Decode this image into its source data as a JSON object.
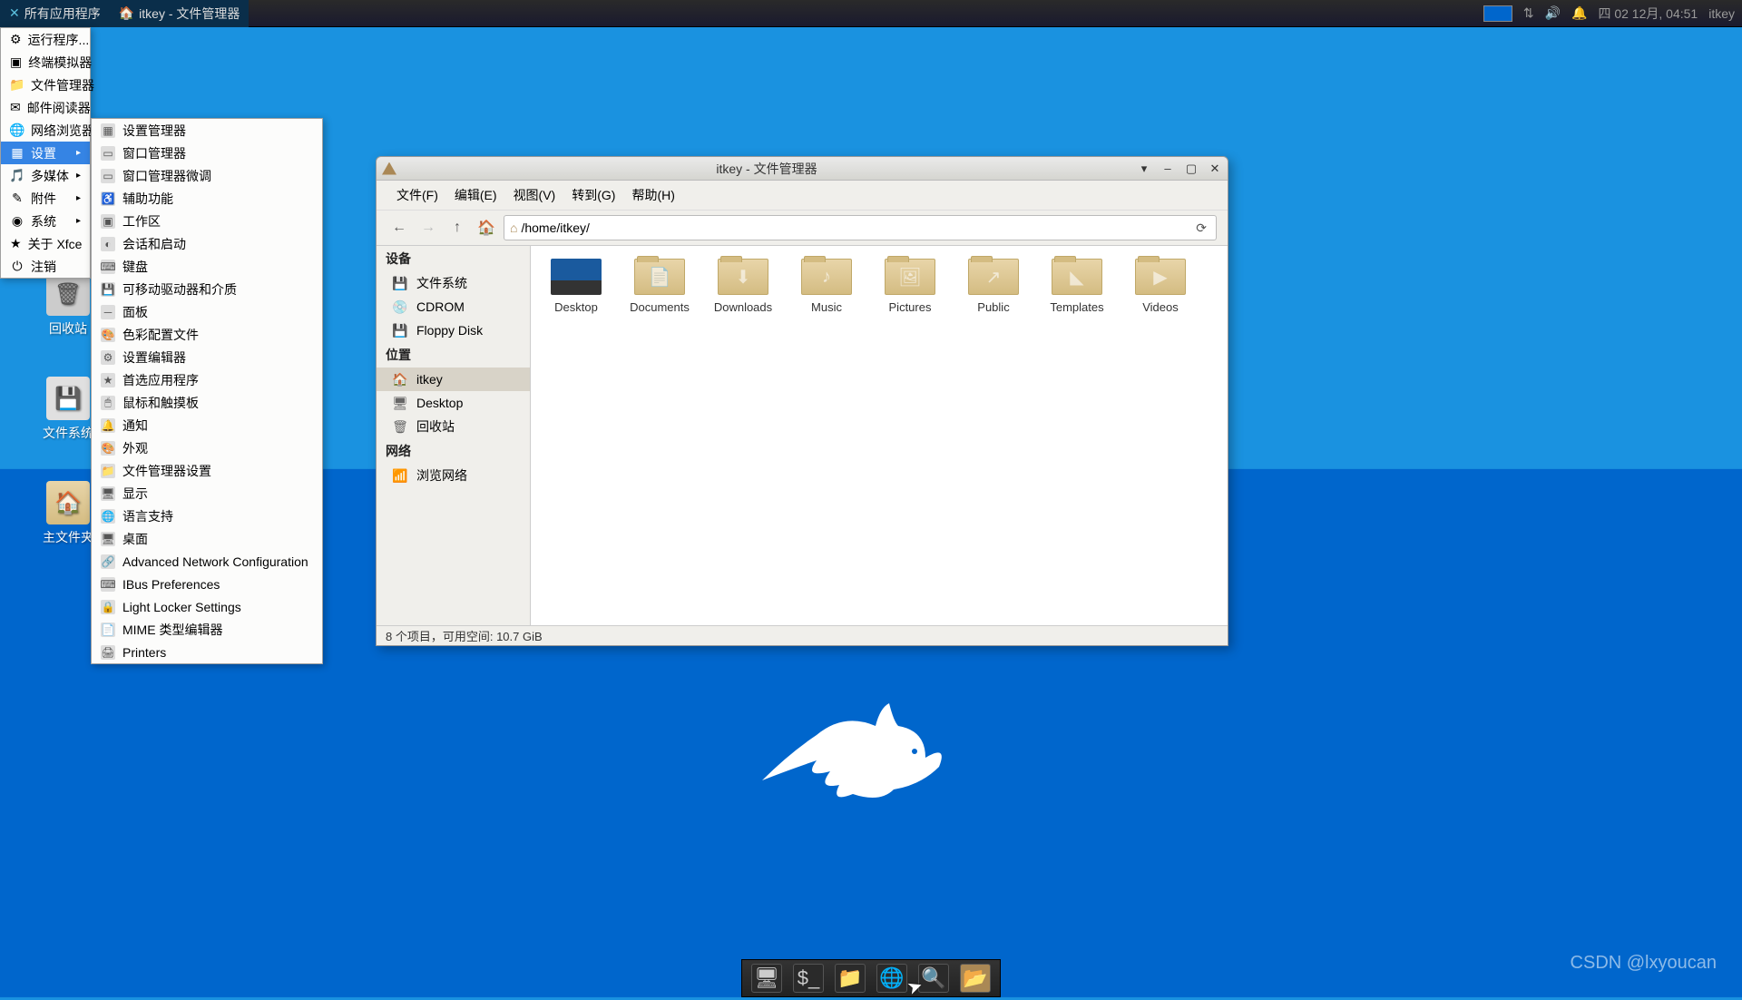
{
  "panel": {
    "apps_menu": "所有应用程序",
    "window_task": "itkey - 文件管理器",
    "clock": "四 02 12月, 04:51",
    "user": "itkey"
  },
  "desktop": {
    "trash": "回收站",
    "filesystem": "文件系统",
    "home": "主文件夹"
  },
  "start_menu": {
    "items": [
      {
        "label": "运行程序...",
        "icon": "⚙"
      },
      {
        "label": "终端模拟器",
        "icon": "▣"
      },
      {
        "label": "文件管理器",
        "icon": "📁"
      },
      {
        "label": "邮件阅读器",
        "icon": "✉"
      },
      {
        "label": "网络浏览器",
        "icon": "🌐"
      },
      {
        "label": "设置",
        "icon": "▦",
        "arrow": true,
        "active": true
      },
      {
        "label": "多媒体",
        "icon": "🎵",
        "arrow": true
      },
      {
        "label": "附件",
        "icon": "✎",
        "arrow": true
      },
      {
        "label": "系统",
        "icon": "◉",
        "arrow": true
      },
      {
        "label": "关于 Xfce",
        "icon": "★"
      },
      {
        "label": "注销",
        "icon": "⏻"
      }
    ]
  },
  "settings_submenu": {
    "items": [
      {
        "label": "设置管理器",
        "icon": "▦"
      },
      {
        "label": "窗口管理器",
        "icon": "▭"
      },
      {
        "label": "窗口管理器微调",
        "icon": "▭"
      },
      {
        "label": "辅助功能",
        "icon": "♿"
      },
      {
        "label": "工作区",
        "icon": "▣"
      },
      {
        "label": "会话和启动",
        "icon": "◐"
      },
      {
        "label": "键盘",
        "icon": "⌨"
      },
      {
        "label": "可移动驱动器和介质",
        "icon": "💾"
      },
      {
        "label": "面板",
        "icon": "─"
      },
      {
        "label": "色彩配置文件",
        "icon": "🎨"
      },
      {
        "label": "设置编辑器",
        "icon": "⚙"
      },
      {
        "label": "首选应用程序",
        "icon": "★"
      },
      {
        "label": "鼠标和触摸板",
        "icon": "🖱"
      },
      {
        "label": "通知",
        "icon": "🔔"
      },
      {
        "label": "外观",
        "icon": "🎨"
      },
      {
        "label": "文件管理器设置",
        "icon": "📁"
      },
      {
        "label": "显示",
        "icon": "🖥"
      },
      {
        "label": "语言支持",
        "icon": "🌐"
      },
      {
        "label": "桌面",
        "icon": "🖥"
      },
      {
        "label": "Advanced Network Configuration",
        "icon": "🔗"
      },
      {
        "label": "IBus Preferences",
        "icon": "⌨"
      },
      {
        "label": "Light Locker Settings",
        "icon": "🔒"
      },
      {
        "label": "MIME 类型编辑器",
        "icon": "📄"
      },
      {
        "label": "Printers",
        "icon": "🖨"
      }
    ]
  },
  "fm": {
    "title": "itkey - 文件管理器",
    "menus": [
      "文件(F)",
      "编辑(E)",
      "视图(V)",
      "转到(G)",
      "帮助(H)"
    ],
    "path": "/home/itkey/",
    "sidebar": {
      "devices_hdr": "设备",
      "devices": [
        {
          "label": "文件系统",
          "icon": "💾"
        },
        {
          "label": "CDROM",
          "icon": "💿"
        },
        {
          "label": "Floppy Disk",
          "icon": "💾"
        }
      ],
      "places_hdr": "位置",
      "places": [
        {
          "label": "itkey",
          "icon": "🏠",
          "active": true
        },
        {
          "label": "Desktop",
          "icon": "🖥"
        },
        {
          "label": "回收站",
          "icon": "🗑"
        }
      ],
      "network_hdr": "网络",
      "network": [
        {
          "label": "浏览网络",
          "icon": "📶"
        }
      ]
    },
    "files": [
      {
        "label": "Desktop",
        "type": "desktop"
      },
      {
        "label": "Documents",
        "glyph": "📄"
      },
      {
        "label": "Downloads",
        "glyph": "⬇"
      },
      {
        "label": "Music",
        "glyph": "♪"
      },
      {
        "label": "Pictures",
        "glyph": "🖼"
      },
      {
        "label": "Public",
        "glyph": "↗"
      },
      {
        "label": "Templates",
        "glyph": "◣"
      },
      {
        "label": "Videos",
        "glyph": "▶"
      }
    ],
    "status": "8 个项目，可用空间: 10.7 GiB"
  },
  "watermark": "CSDN @lxyoucan"
}
